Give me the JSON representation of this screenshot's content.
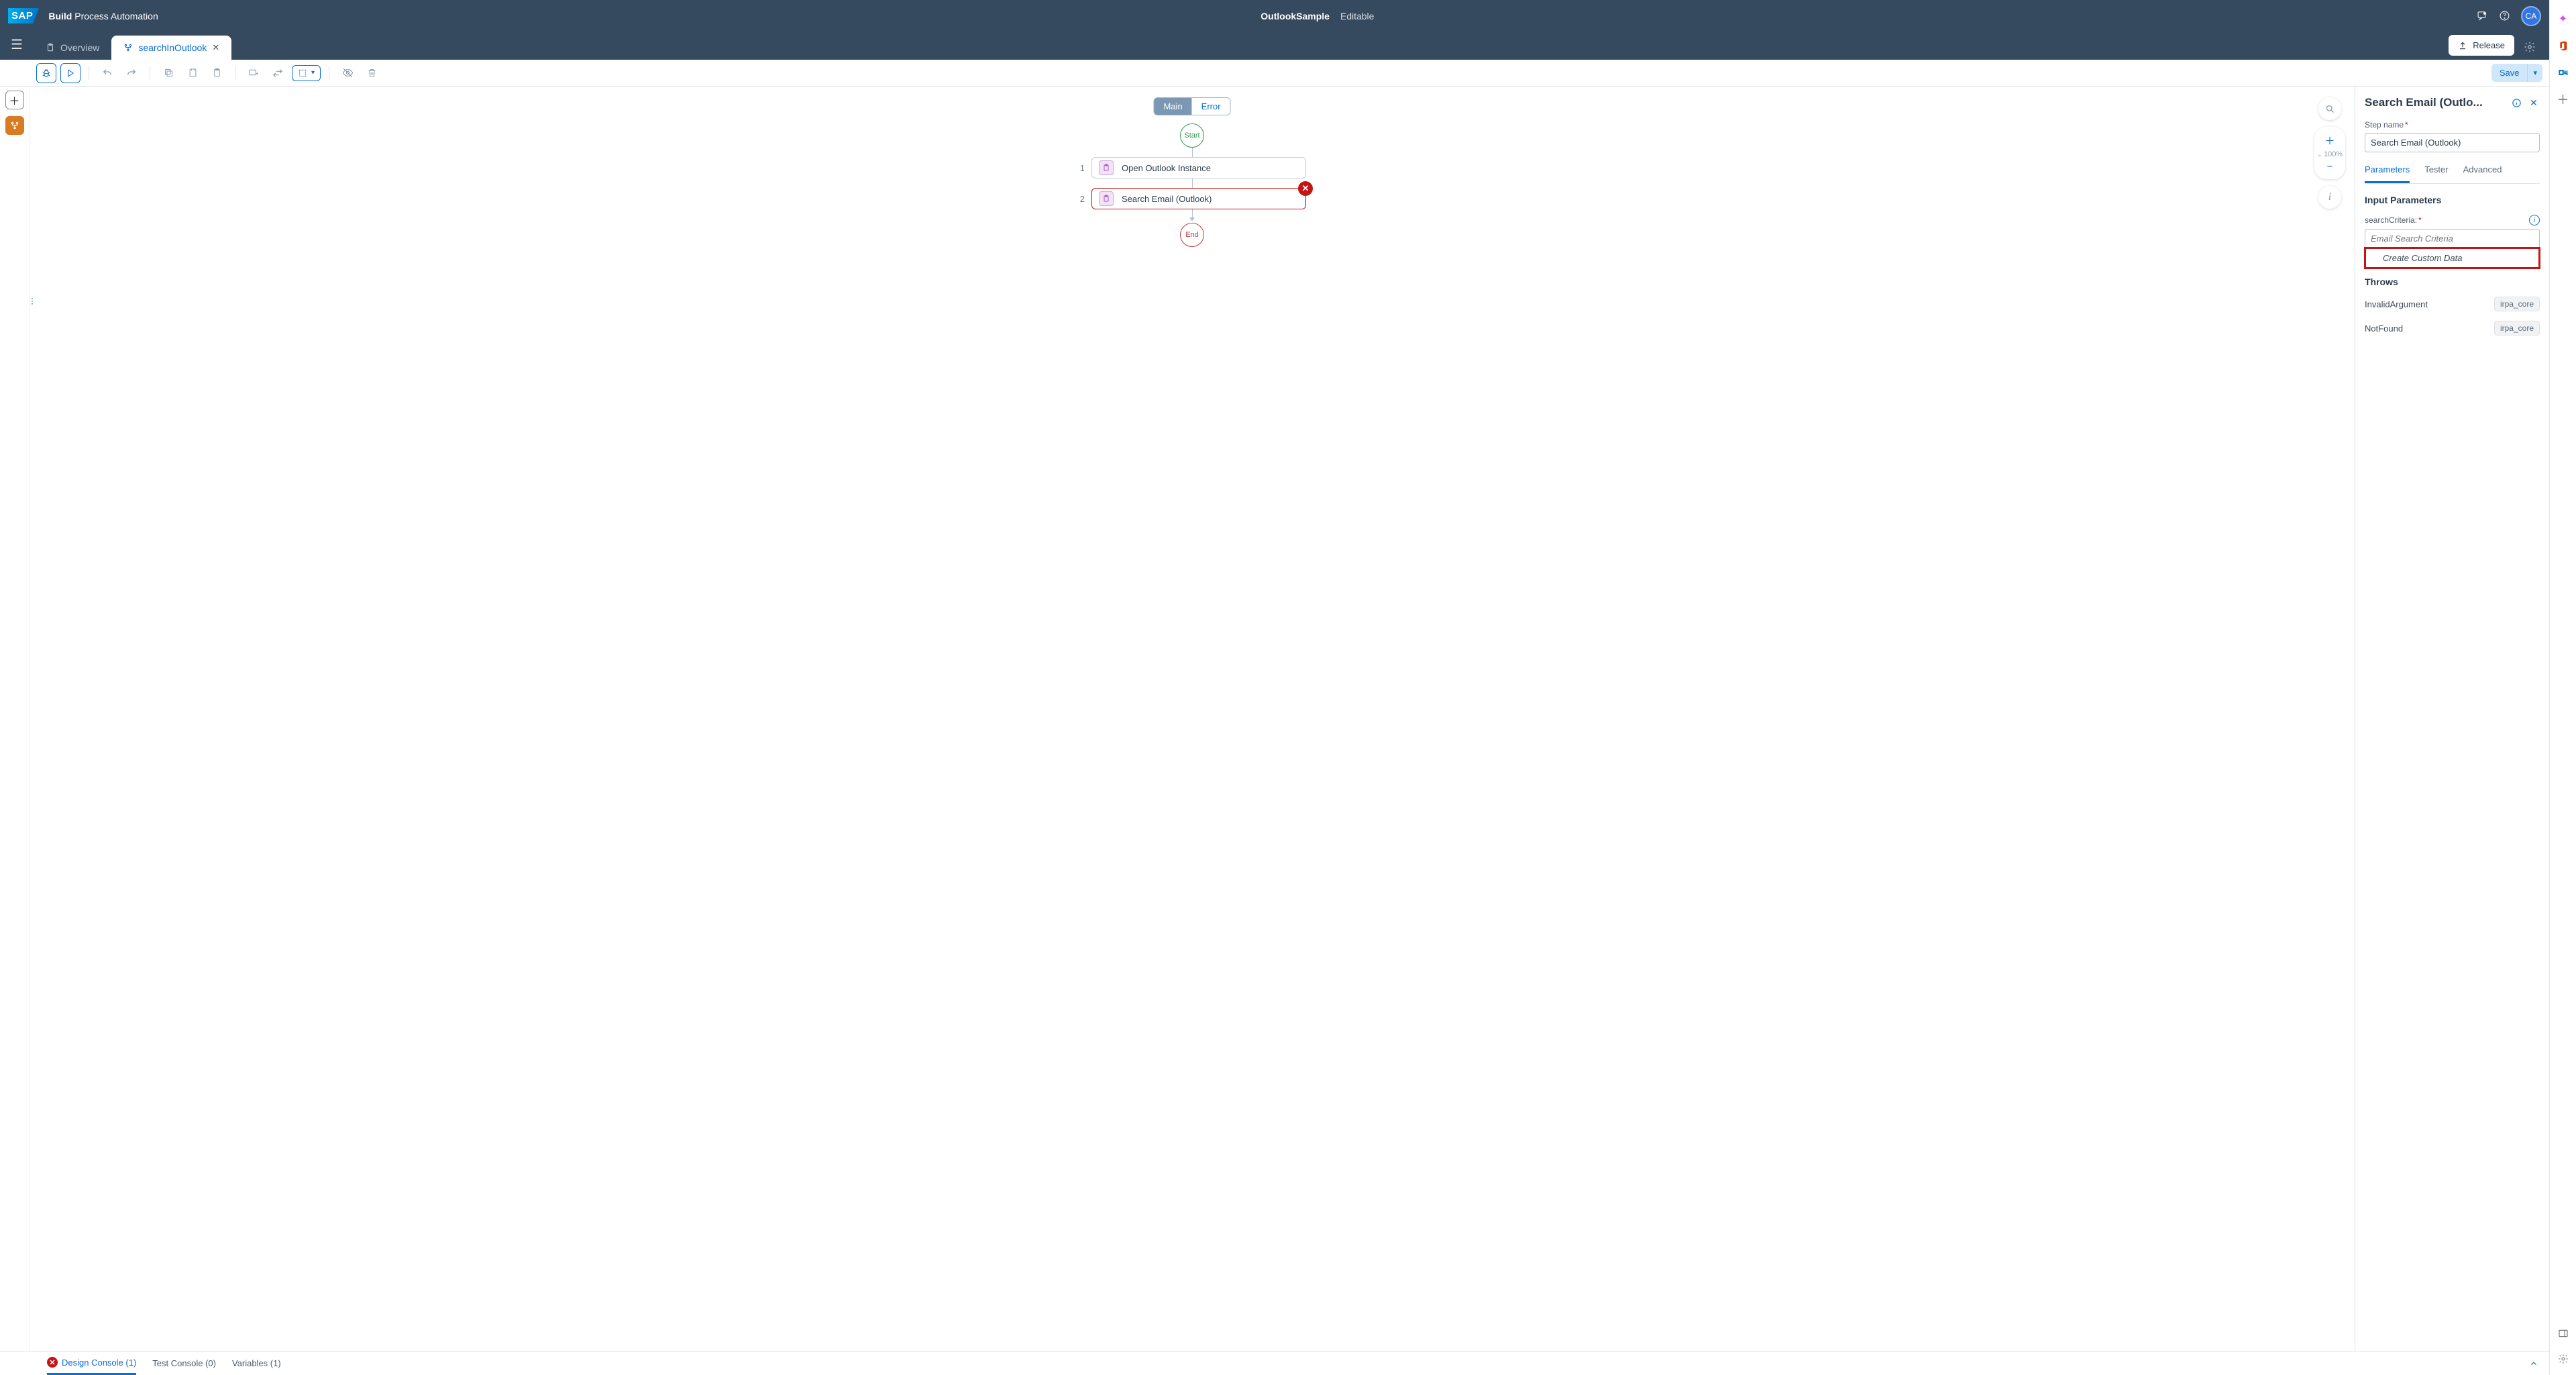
{
  "header": {
    "brand_bold": "Build",
    "brand_rest": " Process Automation",
    "project": "OutlookSample",
    "status": "Editable",
    "avatar": "CA"
  },
  "tabs": {
    "overview": "Overview",
    "active": "searchInOutlook"
  },
  "actions": {
    "release": "Release",
    "save": "Save"
  },
  "canvas": {
    "main_tab": "Main",
    "error_tab": "Error",
    "zoom": "100%",
    "start": "Start",
    "end": "End",
    "steps": [
      {
        "num": "1",
        "label": "Open Outlook Instance"
      },
      {
        "num": "2",
        "label": "Search Email (Outlook)"
      }
    ]
  },
  "props": {
    "title": "Search Email (Outlo...",
    "stepname_label": "Step name",
    "stepname_value": "Search Email (Outlook)",
    "tabs": {
      "parameters": "Parameters",
      "tester": "Tester",
      "advanced": "Advanced"
    },
    "input_params_title": "Input Parameters",
    "search_label": "searchCriteria:",
    "search_placeholder": "Email Search Criteria",
    "dropdown_option": "Create Custom Data",
    "throws_title": "Throws",
    "throws": [
      {
        "name": "InvalidArgument",
        "tag": "irpa_core"
      },
      {
        "name": "NotFound",
        "tag": "irpa_core"
      }
    ]
  },
  "bottom": {
    "design": "Design Console (1)",
    "test": "Test Console (0)",
    "vars": "Variables (1)"
  }
}
